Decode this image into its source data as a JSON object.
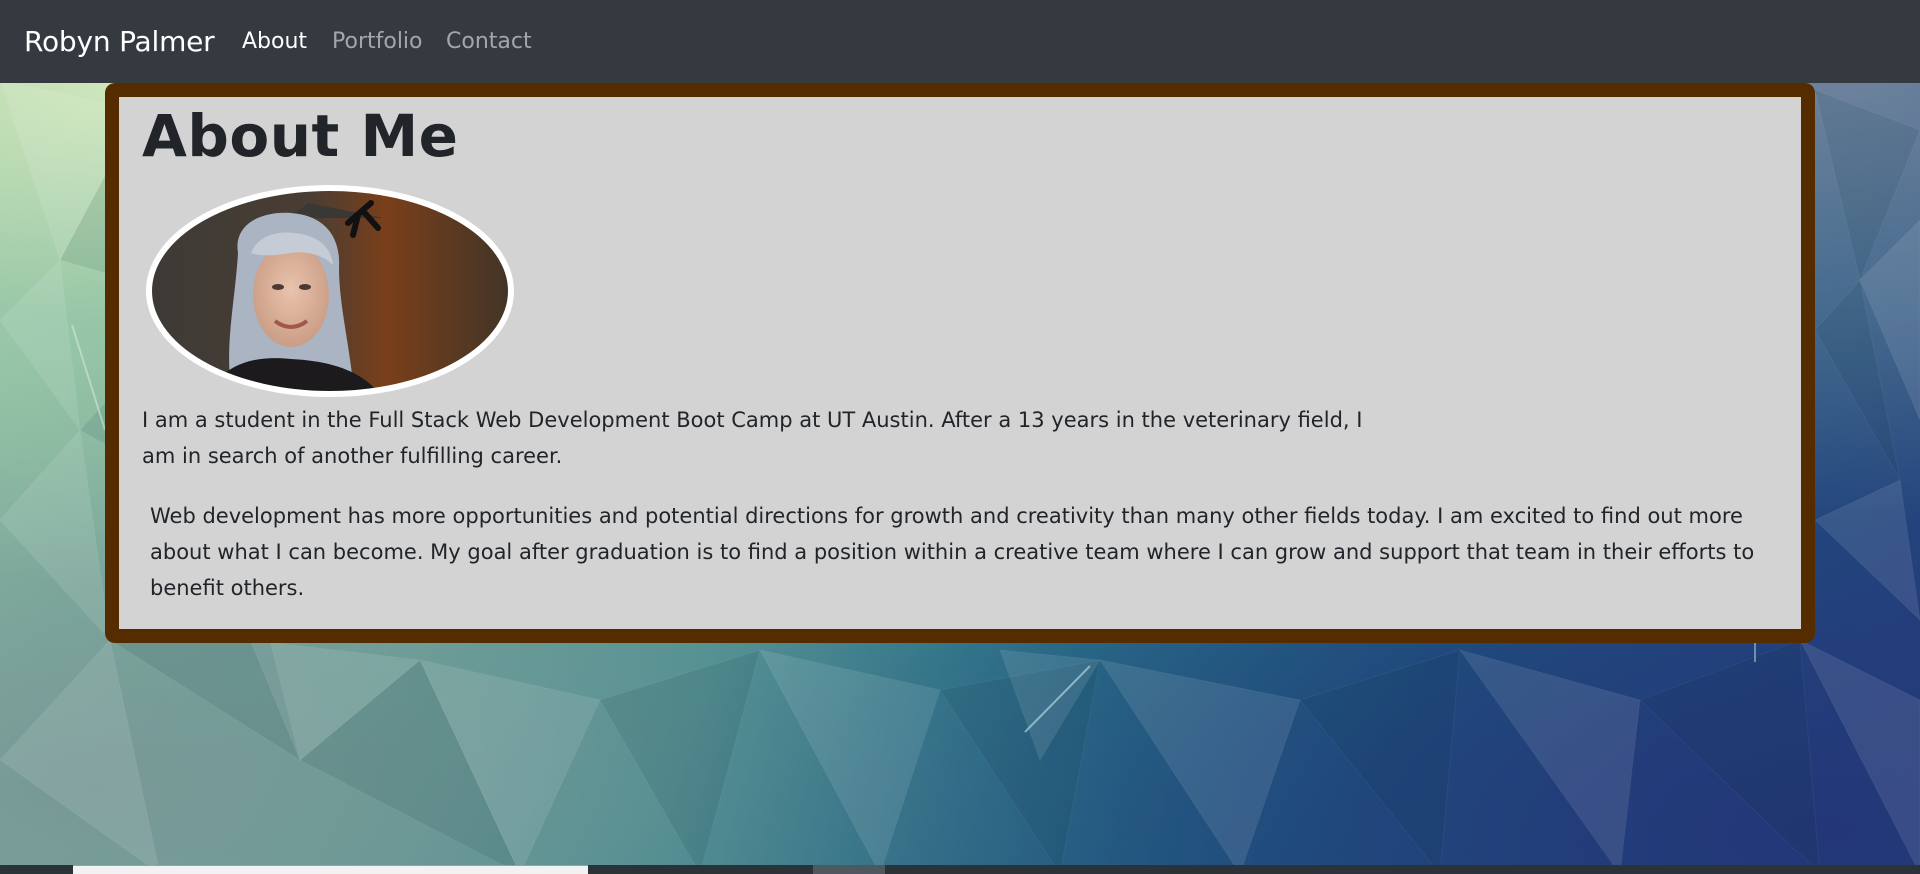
{
  "nav": {
    "brand": "Robyn Palmer",
    "links": [
      {
        "label": "About",
        "active": true
      },
      {
        "label": "Portfolio",
        "active": false
      },
      {
        "label": "Contact",
        "active": false
      }
    ]
  },
  "about": {
    "title": "About Me",
    "paragraphs": [
      "I am a student in the Full Stack Web Development Boot Camp at UT Austin. After a 13 years in the veterinary field, I am in search of another fulfilling career.",
      "Web development has more opportunities and potential directions for growth and creativity than many other fields today. I am excited to find out more about what I can become. My goal after graduation is to find a position within a creative team where I can grow and support that team in their efforts to benefit others."
    ]
  },
  "colors": {
    "navbar": "#343a40",
    "card_border": "#552c00",
    "card_background": "#d3d3d3"
  }
}
